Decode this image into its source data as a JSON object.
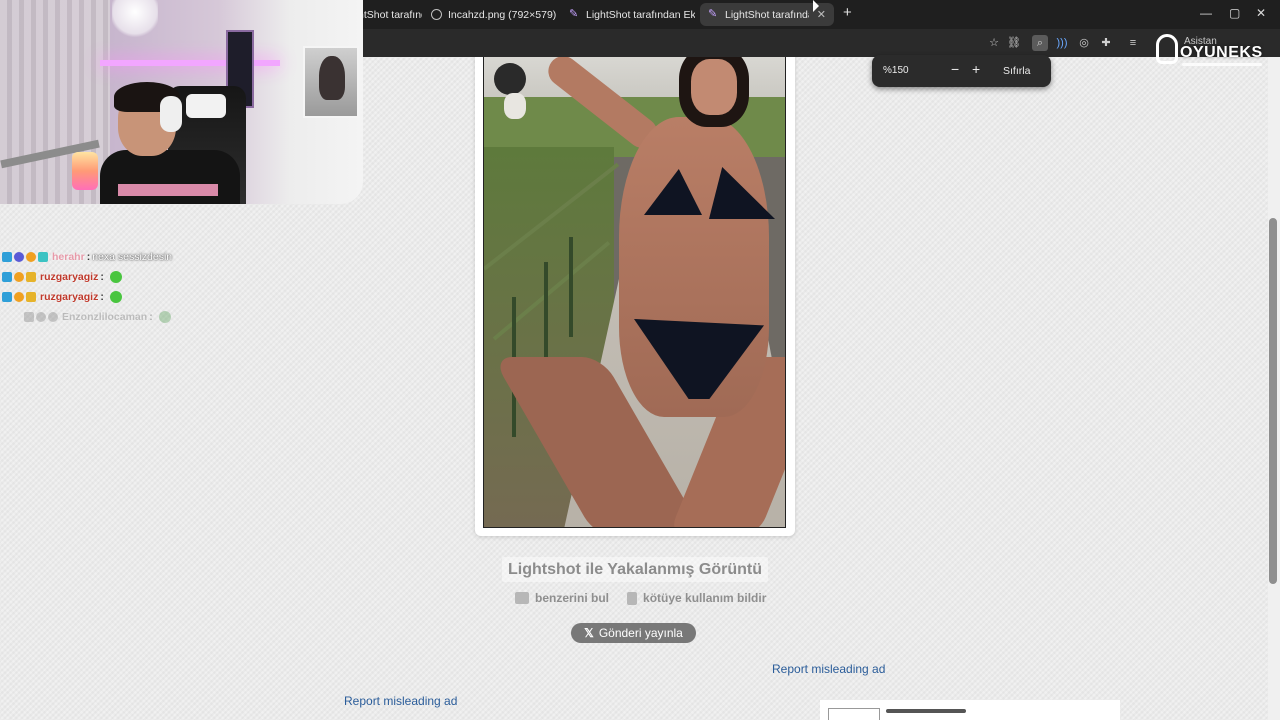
{
  "browser": {
    "tabs": [
      {
        "label": "LightShot tarafından Ekran",
        "active": false,
        "icon": "pen-icon"
      },
      {
        "label": "Incahzd.png (792×579)",
        "active": false,
        "icon": "globe-icon"
      },
      {
        "label": "LightShot tarafından Ekran",
        "active": false,
        "icon": "pen-icon"
      },
      {
        "label": "LightShot tarafından Ekran",
        "active": true,
        "icon": "pen-icon"
      }
    ],
    "assistant_label": "Asistan",
    "zoom": {
      "value": "%150",
      "minus": "−",
      "plus": "+",
      "reset_label": "Sıfırla"
    },
    "window_controls": {
      "minimize": "—",
      "maximize": "▢",
      "close": "✕"
    }
  },
  "overlay": {
    "logo": {
      "text": "OYUNEKS"
    },
    "chat": [
      {
        "user": "herahr",
        "sep": ":",
        "message": "nexa sessizdesin",
        "faded": false,
        "emote": false
      },
      {
        "user": "ruzgaryagiz",
        "sep": ":",
        "message": "",
        "faded": false,
        "emote": true
      },
      {
        "user": "ruzgaryagiz",
        "sep": ":",
        "message": "",
        "faded": false,
        "emote": true
      },
      {
        "user": "Enzonzlilocaman",
        "sep": ":",
        "message": "",
        "faded": true,
        "emote": true
      }
    ]
  },
  "page": {
    "caption": "Lightshot ile Yakalanmış Görüntü",
    "find_similar": "benzerini bul",
    "report_abuse": "kötüye kullanım bildir",
    "tweet_button": "Gönderi yayınla",
    "report_ad_1": "Report misleading ad",
    "report_ad_2": "Report misleading ad"
  },
  "colors": {
    "page_bg": "#e9e9e9",
    "link": "#2b5d9a",
    "chat_user": "#c0392b",
    "tab_bar": "#1f1f1f"
  }
}
